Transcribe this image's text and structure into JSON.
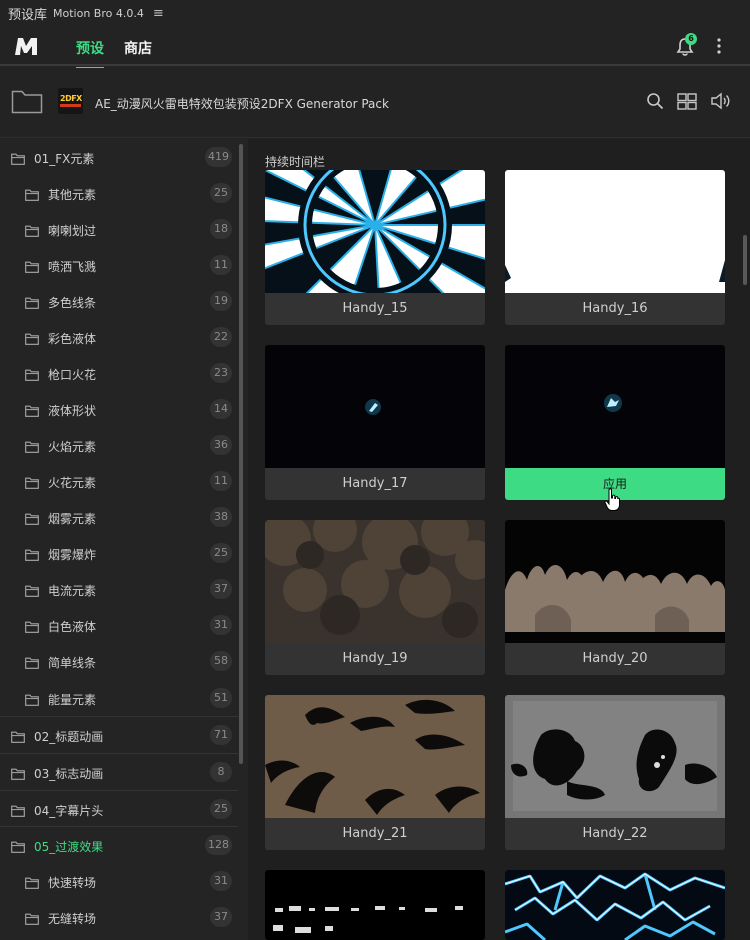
{
  "app": {
    "window_title": "预设库",
    "product": "Motion Bro 4.0.4",
    "tabs": {
      "presets": "预设",
      "store": "商店"
    },
    "notification_count": "6"
  },
  "pack": {
    "thumb_label": "2DFX",
    "title": "AE_动漫风火雷电特效包装预设2DFX Generator Pack"
  },
  "sidebar": {
    "categories": [
      {
        "label": "01_FX元素",
        "count": "419",
        "level": "top",
        "active": false
      },
      {
        "label": "其他元素",
        "count": "25",
        "level": "sub"
      },
      {
        "label": "喇喇划过",
        "count": "18",
        "level": "sub"
      },
      {
        "label": "喷洒飞溅",
        "count": "11",
        "level": "sub"
      },
      {
        "label": "多色线条",
        "count": "19",
        "level": "sub"
      },
      {
        "label": "彩色液体",
        "count": "22",
        "level": "sub"
      },
      {
        "label": "枪口火花",
        "count": "23",
        "level": "sub"
      },
      {
        "label": "液体形状",
        "count": "14",
        "level": "sub"
      },
      {
        "label": "火焰元素",
        "count": "36",
        "level": "sub"
      },
      {
        "label": "火花元素",
        "count": "11",
        "level": "sub"
      },
      {
        "label": "烟雾元素",
        "count": "38",
        "level": "sub"
      },
      {
        "label": "烟雾爆炸",
        "count": "25",
        "level": "sub"
      },
      {
        "label": "电流元素",
        "count": "37",
        "level": "sub"
      },
      {
        "label": "白色液体",
        "count": "31",
        "level": "sub"
      },
      {
        "label": "简单线条",
        "count": "58",
        "level": "sub"
      },
      {
        "label": "能量元素",
        "count": "51",
        "level": "sub"
      },
      {
        "label": "02_标题动画",
        "count": "71",
        "level": "top"
      },
      {
        "label": "03_标志动画",
        "count": "8",
        "level": "top"
      },
      {
        "label": "04_字幕片头",
        "count": "25",
        "level": "top"
      },
      {
        "label": "05_过渡效果",
        "count": "128",
        "level": "top",
        "active": true
      },
      {
        "label": "快速转场",
        "count": "31",
        "level": "sub"
      },
      {
        "label": "无缝转场",
        "count": "37",
        "level": "sub"
      }
    ]
  },
  "main": {
    "section_title": "持续时间栏",
    "apply_label": "应用",
    "presets": [
      {
        "name": "Handy_15"
      },
      {
        "name": "Handy_16"
      },
      {
        "name": "Handy_17"
      },
      {
        "name": ""
      },
      {
        "name": "Handy_19"
      },
      {
        "name": "Handy_20"
      },
      {
        "name": "Handy_21"
      },
      {
        "name": "Handy_22"
      }
    ]
  },
  "colors": {
    "accent": "#3ddc84",
    "panel": "#232323",
    "card": "#333333"
  },
  "icons": [
    "motion-bro-logo",
    "menu-icon",
    "bell-icon",
    "kebab-icon",
    "folder-icon",
    "search-icon",
    "grid-icon",
    "speaker-icon",
    "cursor-hand-icon"
  ]
}
